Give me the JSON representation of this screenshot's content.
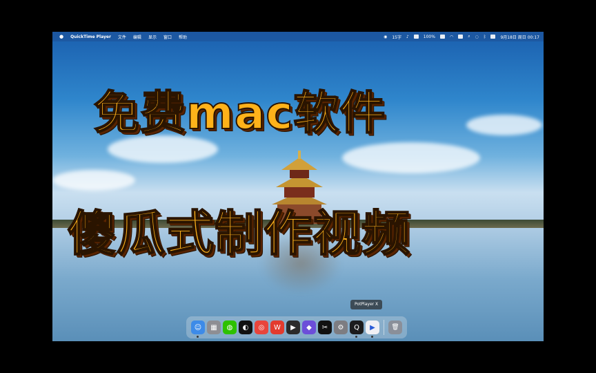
{
  "menubar": {
    "apple": "",
    "app_name": "QuickTime Player",
    "menus": [
      "文件",
      "编辑",
      "显示",
      "窗口",
      "帮助"
    ],
    "status": {
      "count": "15字",
      "battery": "100%",
      "datetime": "9月18日 周日 00:17"
    }
  },
  "overlay": {
    "title_line1": "免费mac软件",
    "title_line2": "傻瓜式制作视频"
  },
  "dock": {
    "tooltip": "PotPlayer X",
    "apps": [
      {
        "name": "finder-icon",
        "color": "#3d8be8",
        "glyph": "☺"
      },
      {
        "name": "launchpad-icon",
        "color": "#8e8e93",
        "glyph": "▦"
      },
      {
        "name": "wechat-icon",
        "color": "#2dc100",
        "glyph": "◍"
      },
      {
        "name": "qq-icon",
        "color": "#111111",
        "glyph": "◐"
      },
      {
        "name": "chrome-icon",
        "color": "#e8453c",
        "glyph": "◎"
      },
      {
        "name": "wps-icon",
        "color": "#e33b2e",
        "glyph": "W"
      },
      {
        "name": "final-cut-icon",
        "color": "#2b2b2b",
        "glyph": "▶"
      },
      {
        "name": "photo-app-icon",
        "color": "#6c4ed9",
        "glyph": "◆"
      },
      {
        "name": "capcut-icon",
        "color": "#111111",
        "glyph": "✂"
      },
      {
        "name": "system-settings-icon",
        "color": "#7d7d82",
        "glyph": "⚙"
      },
      {
        "name": "quicktime-icon",
        "color": "#1c1c1e",
        "glyph": "Q"
      },
      {
        "name": "potplayer-icon",
        "color": "#f0f0f5",
        "glyph": "▶"
      }
    ],
    "trash": {
      "name": "trash-icon",
      "color": "#8a8f99",
      "glyph": "🗑"
    }
  }
}
